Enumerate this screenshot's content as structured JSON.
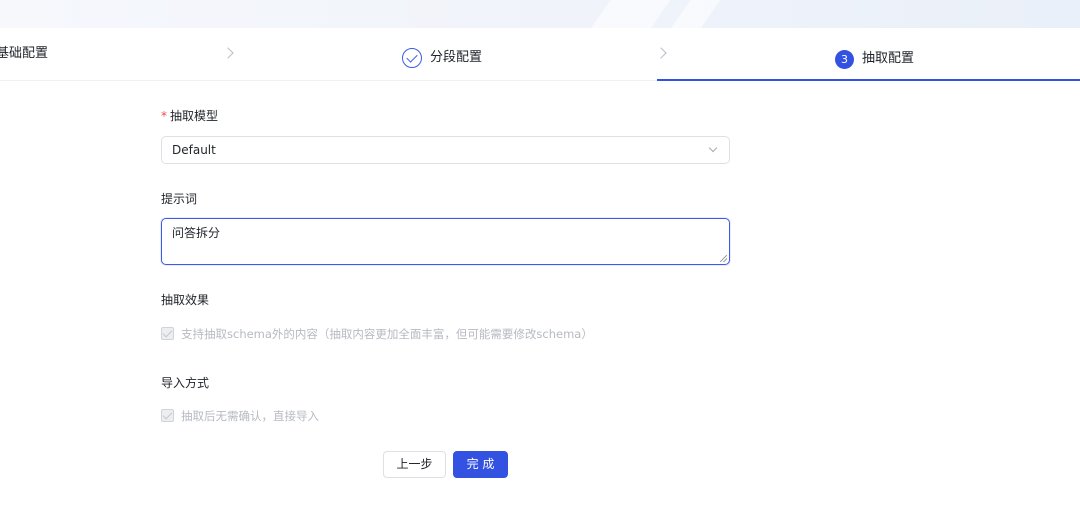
{
  "steps": {
    "step1": {
      "label": "基础配置",
      "status": "done"
    },
    "step2": {
      "label": "分段配置",
      "status": "done"
    },
    "step3": {
      "number": "3",
      "label": "抽取配置",
      "status": "active"
    }
  },
  "form": {
    "model": {
      "required_mark": "*",
      "label": "抽取模型",
      "value": "Default"
    },
    "prompt": {
      "label": "提示词",
      "value": "问答拆分"
    },
    "effect": {
      "label": "抽取效果",
      "option_text": "支持抽取schema外的内容（抽取内容更加全面丰富，但可能需要修改schema）",
      "checked": true,
      "disabled": true
    },
    "import_mode": {
      "label": "导入方式",
      "option_text": "抽取后无需确认，直接导入",
      "checked": true,
      "disabled": true
    }
  },
  "actions": {
    "prev_label": "上一步",
    "finish_label": "完 成"
  },
  "colors": {
    "accent": "#3452e1",
    "required": "#f54a45",
    "disabled_text": "#b6bac1"
  }
}
